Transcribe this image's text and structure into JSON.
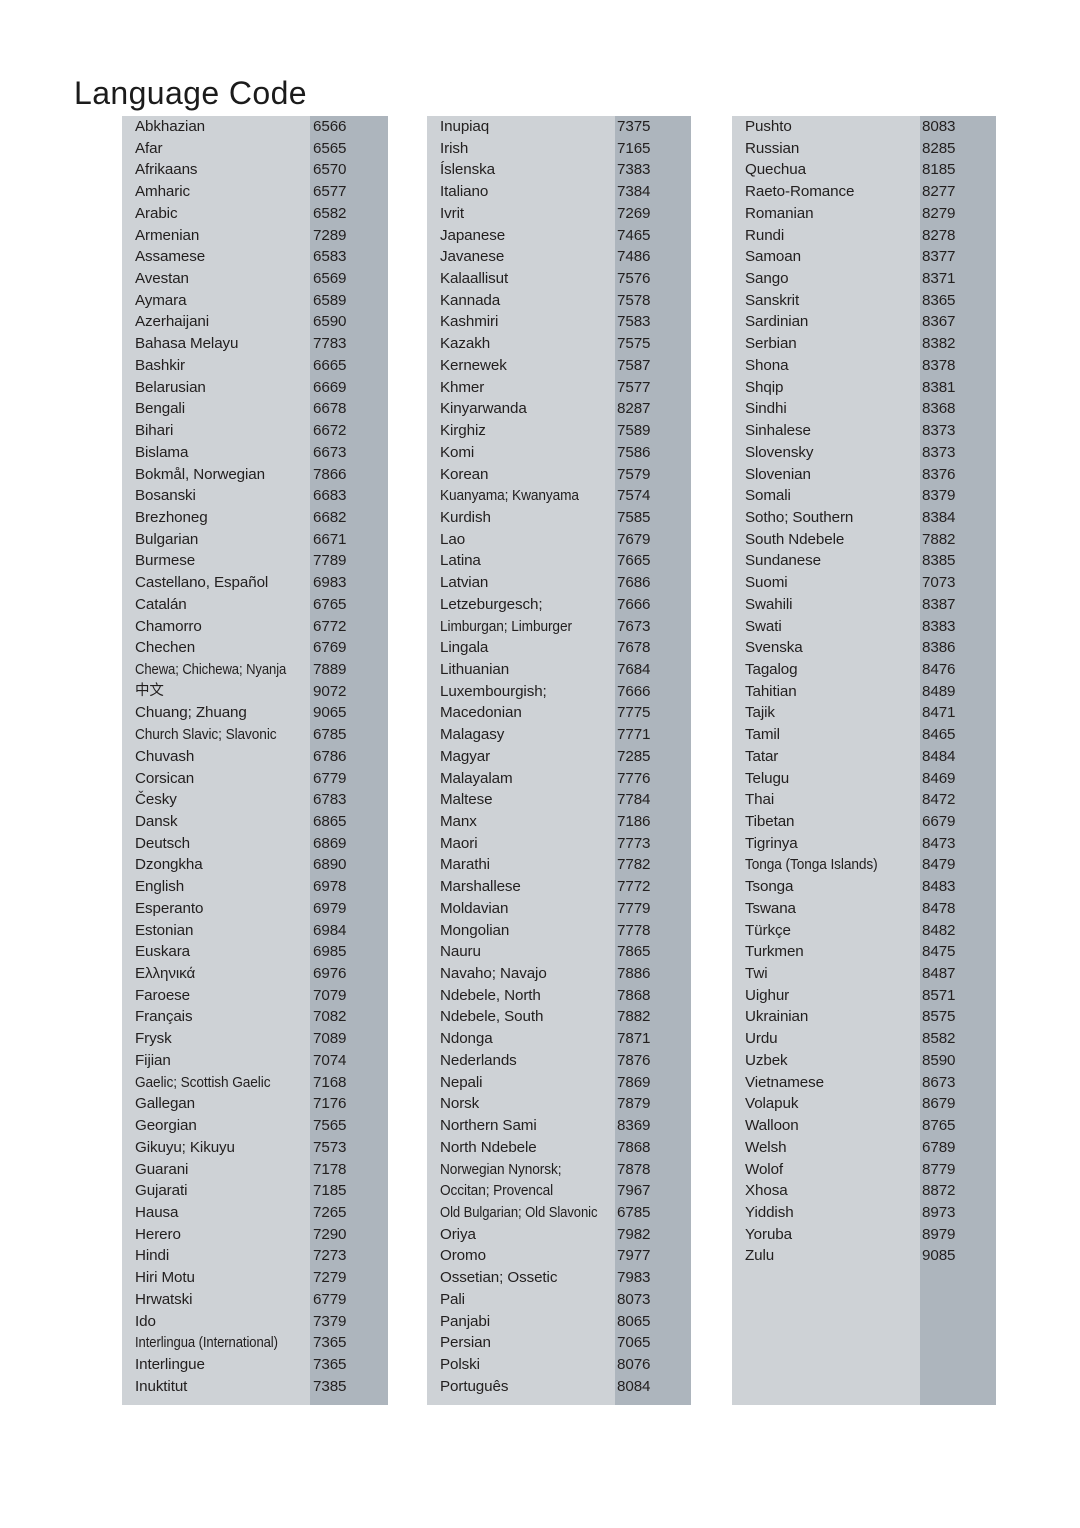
{
  "page": {
    "title": "Language Code"
  },
  "columns": [
    {
      "id": "column-1",
      "rows": [
        {
          "language": "Abkhazian",
          "code": "6566"
        },
        {
          "language": "Afar",
          "code": "6565"
        },
        {
          "language": "Afrikaans",
          "code": "6570"
        },
        {
          "language": "Amharic",
          "code": "6577"
        },
        {
          "language": "Arabic",
          "code": "6582"
        },
        {
          "language": "Armenian",
          "code": "7289"
        },
        {
          "language": "Assamese",
          "code": "6583"
        },
        {
          "language": "Avestan",
          "code": "6569"
        },
        {
          "language": "Aymara",
          "code": "6589"
        },
        {
          "language": "Azerhaijani",
          "code": "6590"
        },
        {
          "language": "Bahasa Melayu",
          "code": "7783"
        },
        {
          "language": "Bashkir",
          "code": "6665"
        },
        {
          "language": "Belarusian",
          "code": "6669"
        },
        {
          "language": "Bengali",
          "code": "6678"
        },
        {
          "language": "Bihari",
          "code": "6672"
        },
        {
          "language": "Bislama",
          "code": "6673"
        },
        {
          "language": "Bokmål, Norwegian",
          "code": "7866"
        },
        {
          "language": "Bosanski",
          "code": "6683"
        },
        {
          "language": "Brezhoneg",
          "code": "6682"
        },
        {
          "language": "Bulgarian",
          "code": "6671"
        },
        {
          "language": "Burmese",
          "code": "7789"
        },
        {
          "language": "Castellano, Español",
          "code": "6983"
        },
        {
          "language": "Catalán",
          "code": "6765"
        },
        {
          "language": "Chamorro",
          "code": "6772"
        },
        {
          "language": "Chechen",
          "code": "6769"
        },
        {
          "language": "Chewa; Chichewa; Nyanja",
          "code": "7889",
          "style": "condensed-more"
        },
        {
          "language": "中文",
          "code": "9072",
          "style": "cjk"
        },
        {
          "language": "Chuang; Zhuang",
          "code": "9065"
        },
        {
          "language": "Church Slavic; Slavonic",
          "code": "6785",
          "style": "condensed"
        },
        {
          "language": "Chuvash",
          "code": "6786"
        },
        {
          "language": "Corsican",
          "code": "6779"
        },
        {
          "language": "Česky",
          "code": "6783"
        },
        {
          "language": "Dansk",
          "code": "6865"
        },
        {
          "language": "Deutsch",
          "code": "6869"
        },
        {
          "language": "Dzongkha",
          "code": "6890"
        },
        {
          "language": "English",
          "code": "6978"
        },
        {
          "language": "Esperanto",
          "code": "6979"
        },
        {
          "language": "Estonian",
          "code": "6984"
        },
        {
          "language": "Euskara",
          "code": "6985"
        },
        {
          "language": "Ελληνικά",
          "code": "6976"
        },
        {
          "language": "Faroese",
          "code": "7079"
        },
        {
          "language": "Français",
          "code": "7082"
        },
        {
          "language": "Frysk",
          "code": "7089"
        },
        {
          "language": "Fijian",
          "code": "7074"
        },
        {
          "language": "Gaelic; Scottish Gaelic",
          "code": "7168",
          "style": "condensed"
        },
        {
          "language": "Gallegan",
          "code": "7176"
        },
        {
          "language": "Georgian",
          "code": "7565"
        },
        {
          "language": "Gikuyu; Kikuyu",
          "code": "7573"
        },
        {
          "language": "Guarani",
          "code": "7178"
        },
        {
          "language": "Gujarati",
          "code": "7185"
        },
        {
          "language": "Hausa",
          "code": "7265"
        },
        {
          "language": "Herero",
          "code": "7290"
        },
        {
          "language": "Hindi",
          "code": "7273"
        },
        {
          "language": "Hiri Motu",
          "code": "7279"
        },
        {
          "language": "Hrwatski",
          "code": "6779"
        },
        {
          "language": "Ido",
          "code": "7379"
        },
        {
          "language": "Interlingua (International)",
          "code": "7365",
          "style": "condensed-more"
        },
        {
          "language": "Interlingue",
          "code": "7365"
        },
        {
          "language": "Inuktitut",
          "code": "7385"
        }
      ]
    },
    {
      "id": "column-2",
      "rows": [
        {
          "language": "Inupiaq",
          "code": "7375"
        },
        {
          "language": "Irish",
          "code": "7165"
        },
        {
          "language": "Íslenska",
          "code": "7383"
        },
        {
          "language": "Italiano",
          "code": "7384"
        },
        {
          "language": "Ivrit",
          "code": "7269"
        },
        {
          "language": "Japanese",
          "code": "7465"
        },
        {
          "language": "Javanese",
          "code": "7486"
        },
        {
          "language": "Kalaallisut",
          "code": "7576"
        },
        {
          "language": "Kannada",
          "code": "7578"
        },
        {
          "language": "Kashmiri",
          "code": "7583"
        },
        {
          "language": "Kazakh",
          "code": "7575"
        },
        {
          "language": "Kernewek",
          "code": "7587"
        },
        {
          "language": "Khmer",
          "code": "7577"
        },
        {
          "language": "Kinyarwanda",
          "code": "8287"
        },
        {
          "language": "Kirghiz",
          "code": "7589"
        },
        {
          "language": "Komi",
          "code": "7586"
        },
        {
          "language": "Korean",
          "code": "7579"
        },
        {
          "language": "Kuanyama; Kwanyama",
          "code": "7574",
          "style": "condensed"
        },
        {
          "language": "Kurdish",
          "code": "7585"
        },
        {
          "language": "Lao",
          "code": "7679"
        },
        {
          "language": "Latina",
          "code": "7665"
        },
        {
          "language": "Latvian",
          "code": "7686"
        },
        {
          "language": "Letzeburgesch;",
          "code": "7666"
        },
        {
          "language": "Limburgan; Limburger",
          "code": "7673",
          "style": "condensed"
        },
        {
          "language": "Lingala",
          "code": "7678"
        },
        {
          "language": "Lithuanian",
          "code": "7684"
        },
        {
          "language": "Luxembourgish;",
          "code": "7666"
        },
        {
          "language": "Macedonian",
          "code": "7775"
        },
        {
          "language": "Malagasy",
          "code": "7771"
        },
        {
          "language": "Magyar",
          "code": "7285"
        },
        {
          "language": "Malayalam",
          "code": "7776"
        },
        {
          "language": "Maltese",
          "code": "7784"
        },
        {
          "language": "Manx",
          "code": "7186"
        },
        {
          "language": "Maori",
          "code": "7773"
        },
        {
          "language": "Marathi",
          "code": "7782"
        },
        {
          "language": "Marshallese",
          "code": "7772"
        },
        {
          "language": "Moldavian",
          "code": "7779"
        },
        {
          "language": "Mongolian",
          "code": "7778"
        },
        {
          "language": "Nauru",
          "code": "7865"
        },
        {
          "language": "Navaho; Navajo",
          "code": "7886"
        },
        {
          "language": "Ndebele, North",
          "code": "7868"
        },
        {
          "language": "Ndebele, South",
          "code": "7882"
        },
        {
          "language": "Ndonga",
          "code": "7871"
        },
        {
          "language": "Nederlands",
          "code": "7876"
        },
        {
          "language": "Nepali",
          "code": "7869"
        },
        {
          "language": "Norsk",
          "code": "7879"
        },
        {
          "language": "Northern Sami",
          "code": "8369"
        },
        {
          "language": "North Ndebele",
          "code": "7868"
        },
        {
          "language": "Norwegian Nynorsk;",
          "code": "7878",
          "style": "condensed"
        },
        {
          "language": "Occitan; Provencal",
          "code": "7967",
          "style": "condensed"
        },
        {
          "language": "Old Bulgarian; Old Slavonic",
          "code": "6785",
          "style": "condensed-more"
        },
        {
          "language": "Oriya",
          "code": "7982"
        },
        {
          "language": "Oromo",
          "code": "7977"
        },
        {
          "language": "Ossetian; Ossetic",
          "code": "7983"
        },
        {
          "language": "Pali",
          "code": "8073"
        },
        {
          "language": "Panjabi",
          "code": "8065"
        },
        {
          "language": "Persian",
          "code": "7065"
        },
        {
          "language": "Polski",
          "code": "8076"
        },
        {
          "language": "Português",
          "code": "8084"
        }
      ]
    },
    {
      "id": "column-3",
      "rows": [
        {
          "language": "Pushto",
          "code": "8083"
        },
        {
          "language": "Russian",
          "code": "8285"
        },
        {
          "language": "Quechua",
          "code": "8185"
        },
        {
          "language": "Raeto-Romance",
          "code": "8277"
        },
        {
          "language": "Romanian",
          "code": "8279"
        },
        {
          "language": "Rundi",
          "code": "8278"
        },
        {
          "language": "Samoan",
          "code": "8377"
        },
        {
          "language": "Sango",
          "code": "8371"
        },
        {
          "language": "Sanskrit",
          "code": "8365"
        },
        {
          "language": "Sardinian",
          "code": "8367"
        },
        {
          "language": "Serbian",
          "code": "8382"
        },
        {
          "language": "Shona",
          "code": "8378"
        },
        {
          "language": "Shqip",
          "code": "8381"
        },
        {
          "language": "Sindhi",
          "code": "8368"
        },
        {
          "language": "Sinhalese",
          "code": "8373"
        },
        {
          "language": "Slovensky",
          "code": "8373"
        },
        {
          "language": "Slovenian",
          "code": "8376"
        },
        {
          "language": "Somali",
          "code": "8379"
        },
        {
          "language": "Sotho; Southern",
          "code": "8384"
        },
        {
          "language": "South Ndebele",
          "code": "7882"
        },
        {
          "language": "Sundanese",
          "code": "8385"
        },
        {
          "language": "Suomi",
          "code": "7073"
        },
        {
          "language": "Swahili",
          "code": "8387"
        },
        {
          "language": "Swati",
          "code": "8383"
        },
        {
          "language": "Svenska",
          "code": "8386"
        },
        {
          "language": "Tagalog",
          "code": "8476"
        },
        {
          "language": "Tahitian",
          "code": "8489"
        },
        {
          "language": "Tajik",
          "code": "8471"
        },
        {
          "language": "Tamil",
          "code": "8465"
        },
        {
          "language": "Tatar",
          "code": "8484"
        },
        {
          "language": "Telugu",
          "code": "8469"
        },
        {
          "language": "Thai",
          "code": "8472"
        },
        {
          "language": "Tibetan",
          "code": "6679"
        },
        {
          "language": "Tigrinya",
          "code": "8473"
        },
        {
          "language": "Tonga (Tonga Islands)",
          "code": "8479",
          "style": "condensed"
        },
        {
          "language": "Tsonga",
          "code": "8483"
        },
        {
          "language": "Tswana",
          "code": "8478"
        },
        {
          "language": "Türkçe",
          "code": "8482"
        },
        {
          "language": "Turkmen",
          "code": "8475"
        },
        {
          "language": "Twi",
          "code": "8487"
        },
        {
          "language": "Uighur",
          "code": "8571"
        },
        {
          "language": "Ukrainian",
          "code": "8575"
        },
        {
          "language": "Urdu",
          "code": "8582"
        },
        {
          "language": "Uzbek",
          "code": "8590"
        },
        {
          "language": "Vietnamese",
          "code": "8673"
        },
        {
          "language": "Volapuk",
          "code": "8679"
        },
        {
          "language": "Walloon",
          "code": "8765"
        },
        {
          "language": "Welsh",
          "code": "6789"
        },
        {
          "language": "Wolof",
          "code": "8779"
        },
        {
          "language": "Xhosa",
          "code": "8872"
        },
        {
          "language": "Yiddish",
          "code": "8973"
        },
        {
          "language": "Yoruba",
          "code": "8979"
        },
        {
          "language": "Zulu",
          "code": "9085"
        }
      ]
    }
  ],
  "colors": {
    "page_background": "#ffffff",
    "block_background": "#ced2d6",
    "code_band_background": "#adb5bd",
    "text": "#221f1f",
    "title_text": "#1b1b1b"
  }
}
